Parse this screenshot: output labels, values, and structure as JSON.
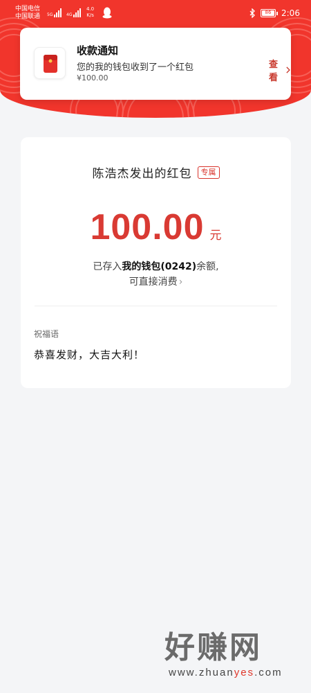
{
  "status_bar": {
    "carrier1": "中国电信",
    "carrier2": "中国联通",
    "net_tag_5g": "5G",
    "net_tag_4g": "4G",
    "speed_value": "4.0",
    "speed_unit": "K/s",
    "battery": "86",
    "time": "2:06"
  },
  "notification": {
    "title": "收款通知",
    "body": "您的我的钱包收到了一个红包",
    "amount": "¥100.00",
    "view_label": "查看"
  },
  "receipt": {
    "sender_line": "陈浩杰发出的红包",
    "tag": "专属",
    "amount": "100.00",
    "unit": "元",
    "deposit_prefix": "已存入",
    "wallet_name": "我的钱包(0242)",
    "deposit_suffix": "余额,",
    "spend_link": "可直接消费",
    "wish_label": "祝福语",
    "wish_text": "恭喜发财，大吉大利！"
  },
  "watermark": {
    "brand": "好赚网",
    "url_part1": "www.zhuan",
    "url_accent": "yes",
    "url_part2": ".com"
  },
  "colors": {
    "header_red": "#f1352c",
    "amount_red": "#d93a33",
    "background": "#f4f5f7"
  }
}
